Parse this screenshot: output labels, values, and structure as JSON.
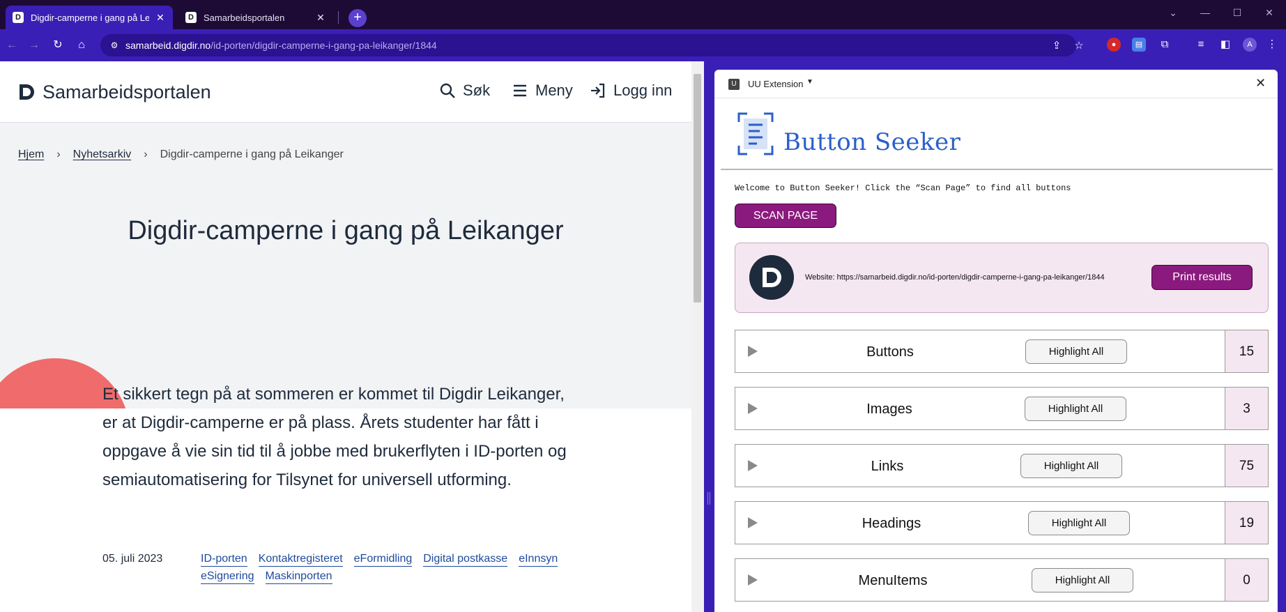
{
  "browser": {
    "tabs": [
      {
        "favicon": "D",
        "title": "Digdir-camperne i gang på Leikanger",
        "active": true
      },
      {
        "favicon": "D",
        "title": "Samarbeidsportalen",
        "active": false
      }
    ],
    "url_host": "samarbeid.digdir.no",
    "url_path": "/id-porten/digdir-camperne-i-gang-pa-leikanger/1844",
    "profile_initial": "A",
    "accent_color": "#3a1fb6",
    "tabstrip_color": "#1d0b36"
  },
  "site": {
    "title": "Samarbeidsportalen",
    "nav": {
      "search": "Søk",
      "menu": "Meny",
      "login": "Logg inn"
    },
    "breadcrumb": [
      {
        "label": "Hjem",
        "link": true
      },
      {
        "label": "Nyhetsarkiv",
        "link": true
      },
      {
        "label": "Digdir-camperne i gang på Leikanger",
        "link": false
      }
    ],
    "article": {
      "title": "Digdir-camperne i gang på Leikanger",
      "lead": "Et sikkert tegn på at sommeren er kommet til Digdir Leikanger, er at Digdir-camperne er på plass. Årets studenter har fått i oppgave å vie sin tid til å jobbe med brukerflyten i ID-porten og semiautomatisering for Tilsynet for universell utforming.",
      "date": "05. juli 2023",
      "tags": [
        "ID-porten",
        "Kontaktregisteret",
        "eFormidling",
        "Digital postkasse",
        "eInnsyn",
        "eSignering",
        "Maskinporten"
      ]
    },
    "hero_circle_color": "#f06b6b"
  },
  "side_panel": {
    "name": "UU Extension",
    "badge": "U",
    "app_title": "Button Seeker",
    "welcome": "Welcome to Button Seeker! Click the “Scan Page” to find all buttons",
    "scan_button": "SCAN PAGE",
    "website_label": "Website: https://samarbeid.digdir.no/id-porten/digdir-camperne-i-gang-pa-leikanger/1844",
    "print_button": "Print results",
    "highlight_label": "Highlight All",
    "brand_color": "#8b1a7e",
    "results": [
      {
        "label": "Buttons",
        "count": "15"
      },
      {
        "label": "Images",
        "count": "3"
      },
      {
        "label": "Links",
        "count": "75"
      },
      {
        "label": "Headings",
        "count": "19"
      },
      {
        "label": "MenuItems",
        "count": "0"
      }
    ]
  }
}
